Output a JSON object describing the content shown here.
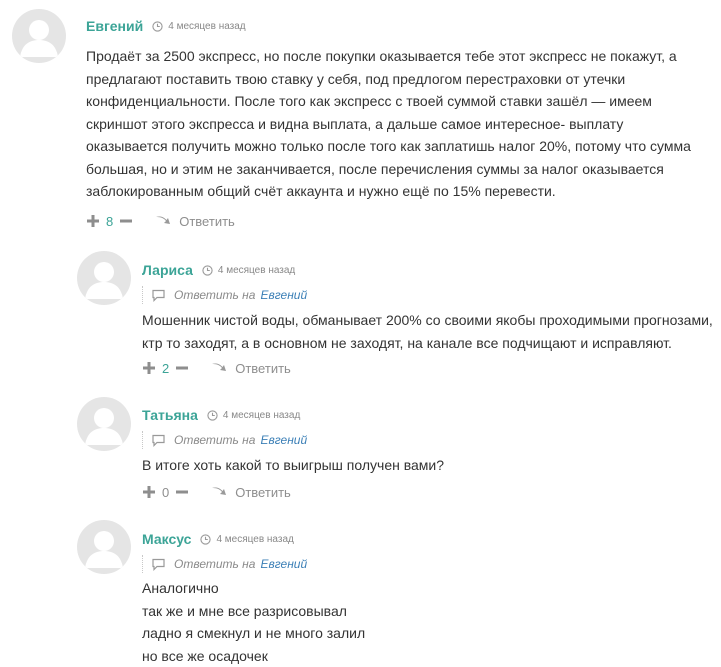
{
  "comments": [
    {
      "author": "Евгений",
      "time": "4 месяцев назад",
      "body_lines": [
        "Продаёт за 2500 экспресс, но после покупки оказывается тебе этот экспресс не покажут, а",
        "предлагают поставить твою ставку у себя, под предлогом перестраховки от утечки",
        "конфиденциальности. После того как экспресс с твоей суммой ставки зашёл — имеем",
        "скриншот этого экспресса и видна выплата, а дальше самое интересное- выплату",
        "оказывается получить можно только после того как заплатишь налог 20%, потому что сумма",
        "большая, но и этим не заканчивается, после перечисления суммы за налог оказывается",
        "заблокированным общий счёт аккаунта и нужно ещё по 15% перевести."
      ],
      "votes": "8",
      "reply_label": "Ответить"
    },
    {
      "author": "Лариса",
      "time": "4 месяцев назад",
      "reply_to_label": "Ответить на",
      "reply_to_name": "Евгений",
      "body_lines": [
        "Мошенник чистой воды, обманывает 200% со своими якобы проходимыми прогнозами,",
        "ктр то заходят, а в основном не заходят, на канале все подчищают и исправляют."
      ],
      "votes": "2",
      "reply_label": "Ответить"
    },
    {
      "author": "Татьяна",
      "time": "4 месяцев назад",
      "reply_to_label": "Ответить на",
      "reply_to_name": "Евгений",
      "body_lines": [
        "В итоге хоть какой то выигрыш получен вами?"
      ],
      "votes": "0",
      "reply_label": "Ответить"
    },
    {
      "author": "Максус",
      "time": "4 месяцев назад",
      "reply_to_label": "Ответить на",
      "reply_to_name": "Евгений",
      "body_lines": [
        "Аналогично",
        "так же и мне все разрисовывал",
        "ладно я смекнул и не много залил",
        "но все же осадочек"
      ]
    }
  ],
  "colors": {
    "author": "#3ca497",
    "vote_count": "#3ca497",
    "reply_to_name": "#3b7fb6",
    "muted": "#8e8e8e",
    "avatar_bg": "#e5e5e5"
  },
  "icons": [
    "user-avatar-icon",
    "clock-icon",
    "comment-icon",
    "plus-icon",
    "minus-icon",
    "reply-arrow-icon"
  ]
}
